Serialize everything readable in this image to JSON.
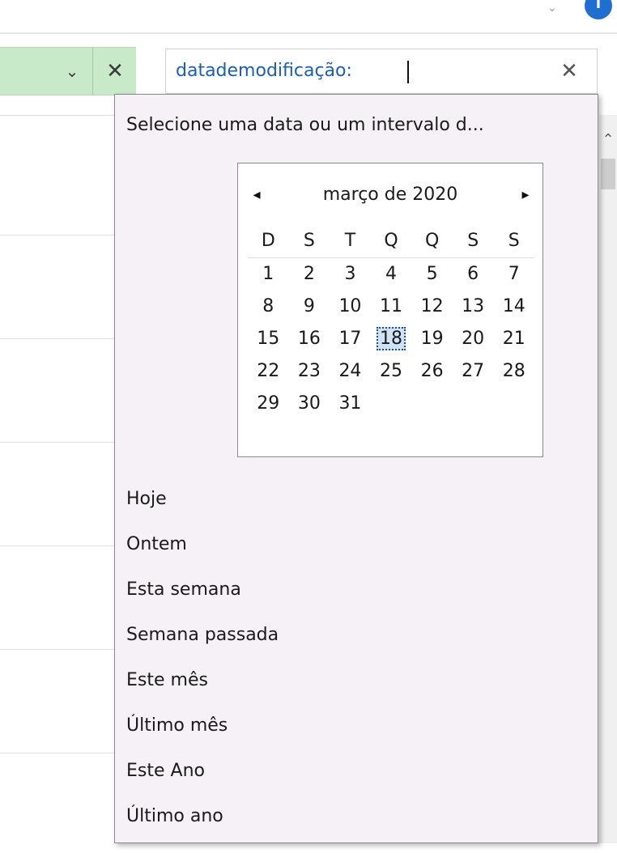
{
  "topbar": {
    "chevron_icon": "chevron-down-icon",
    "info_icon": "info-icon",
    "info_glyph": "i",
    "info_color": "#1f6fd1"
  },
  "address_bar": {
    "dropdown_icon": "chevron-down-icon",
    "dropdown_glyph": "⌄",
    "clear_icon": "close-icon",
    "clear_glyph": "✕",
    "bg_color": "#c9eac9"
  },
  "search": {
    "value": "datademodificação:",
    "clear_glyph": "✕",
    "text_color": "#1a5fb4"
  },
  "popup": {
    "prompt": "Selecione uma data ou um intervalo d...",
    "calendar": {
      "month_title": "março de 2020",
      "prev_glyph": "◂",
      "next_glyph": "▸",
      "weekday_headers": [
        "D",
        "S",
        "T",
        "Q",
        "Q",
        "S",
        "S"
      ],
      "weeks": [
        [
          "1",
          "2",
          "3",
          "4",
          "5",
          "6",
          "7"
        ],
        [
          "8",
          "9",
          "10",
          "11",
          "12",
          "13",
          "14"
        ],
        [
          "15",
          "16",
          "17",
          "18",
          "19",
          "20",
          "21"
        ],
        [
          "22",
          "23",
          "24",
          "25",
          "26",
          "27",
          "28"
        ],
        [
          "29",
          "30",
          "31",
          "",
          "",
          "",
          ""
        ]
      ],
      "selected_day": "18"
    },
    "options": [
      "Hoje",
      "Ontem",
      "Esta semana",
      "Semana passada",
      "Este mês",
      "Último mês",
      "Este Ano",
      "Último ano"
    ]
  },
  "scrollbar": {
    "up_glyph": "⌃"
  }
}
